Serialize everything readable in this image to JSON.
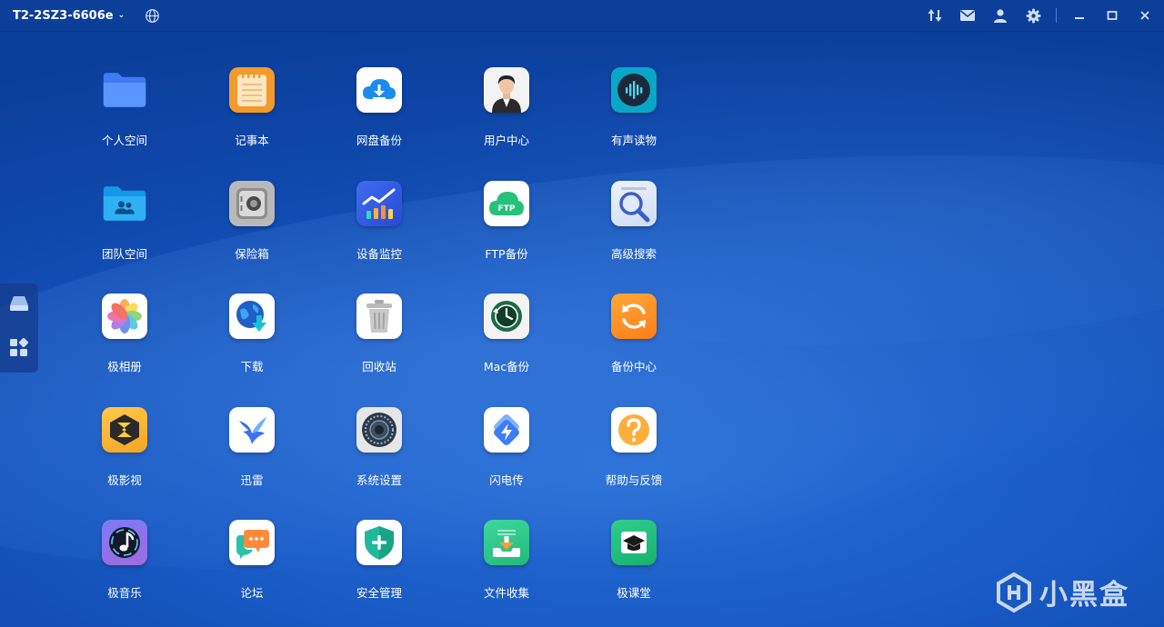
{
  "titlebar": {
    "device_name": "T2-2SZ3-6606e",
    "chevron": "⌄",
    "icons": [
      "globe-icon",
      "transfer-icon",
      "mail-icon",
      "user-icon",
      "gear-icon",
      "minimize-icon",
      "maximize-icon",
      "close-icon"
    ]
  },
  "dock": {
    "items": [
      {
        "icon": "drive-icon"
      },
      {
        "icon": "widgets-icon"
      }
    ]
  },
  "apps": [
    {
      "label": "个人空间",
      "icon": "folder-icon"
    },
    {
      "label": "记事本",
      "icon": "notepad-icon"
    },
    {
      "label": "网盘备份",
      "icon": "cloud-download-icon"
    },
    {
      "label": "用户中心",
      "icon": "user-avatar-icon"
    },
    {
      "label": "有声读物",
      "icon": "audio-wave-icon"
    },
    {
      "label": "团队空间",
      "icon": "team-folder-icon"
    },
    {
      "label": "保险箱",
      "icon": "safe-icon"
    },
    {
      "label": "设备监控",
      "icon": "chart-icon"
    },
    {
      "label": "FTP备份",
      "icon": "ftp-cloud-icon"
    },
    {
      "label": "高级搜索",
      "icon": "magnifier-icon"
    },
    {
      "label": "极相册",
      "icon": "photos-flower-icon"
    },
    {
      "label": "下载",
      "icon": "globe-download-icon"
    },
    {
      "label": "回收站",
      "icon": "trash-icon"
    },
    {
      "label": "Mac备份",
      "icon": "time-machine-icon"
    },
    {
      "label": "备份中心",
      "icon": "sync-icon"
    },
    {
      "label": "极影视",
      "icon": "video-logo-icon"
    },
    {
      "label": "迅雷",
      "icon": "bird-icon"
    },
    {
      "label": "系统设置",
      "icon": "settings-dial-icon"
    },
    {
      "label": "闪电传",
      "icon": "lightning-icon"
    },
    {
      "label": "帮助与反馈",
      "icon": "question-icon"
    },
    {
      "label": "极音乐",
      "icon": "music-note-icon"
    },
    {
      "label": "论坛",
      "icon": "chat-bubbles-icon"
    },
    {
      "label": "安全管理",
      "icon": "shield-plus-icon"
    },
    {
      "label": "文件收集",
      "icon": "inbox-tray-icon"
    },
    {
      "label": "极课堂",
      "icon": "graduation-cap-icon"
    }
  ],
  "watermark": {
    "text": "小黑盒",
    "icon": "heybox-logo-icon"
  },
  "colors": {
    "accent": "#1a5bc6",
    "titlebar": "#0c3f99"
  }
}
